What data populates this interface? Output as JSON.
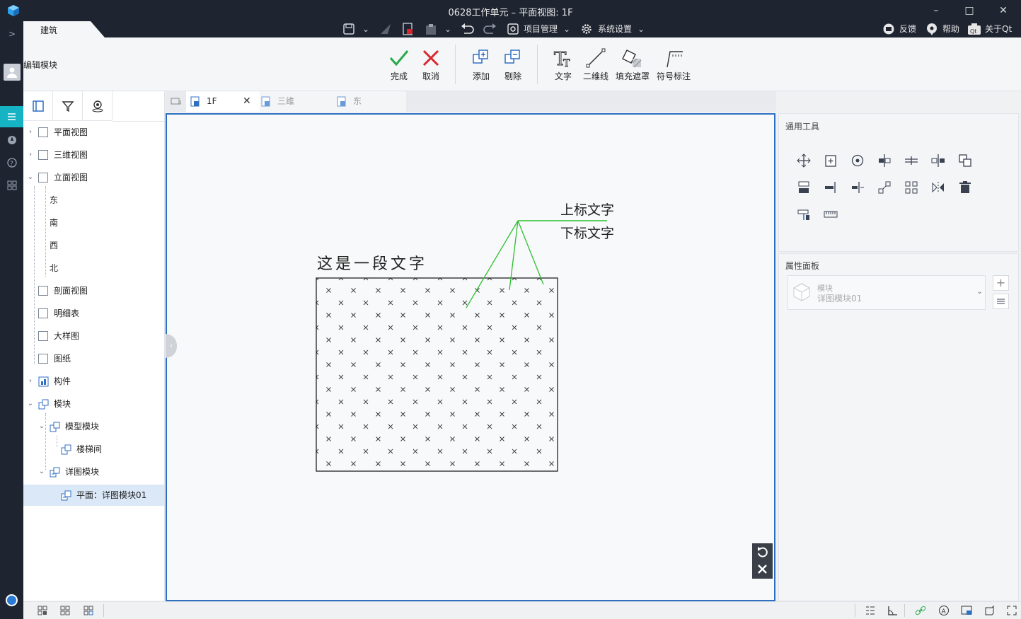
{
  "window": {
    "title": "0628工作单元 – 平面视图: 1F",
    "min": "–",
    "max": "□",
    "close": "✕"
  },
  "menubar": {
    "active_tab": "建筑",
    "project_menu": "项目管理",
    "settings_menu": "系统设置",
    "feedback": "反馈",
    "help": "帮助",
    "about": "关于Qt"
  },
  "ribbon": {
    "mode_label": "编辑模块",
    "buttons": [
      {
        "label": "完成",
        "icon": "check-icon"
      },
      {
        "label": "取消",
        "icon": "cross-icon"
      },
      {
        "label": "添加",
        "icon": "add-block-icon"
      },
      {
        "label": "剔除",
        "icon": "remove-block-icon"
      },
      {
        "label": "文字",
        "icon": "text-icon"
      },
      {
        "label": "二维线",
        "icon": "line-icon"
      },
      {
        "label": "填充遮罩",
        "icon": "fill-mask-icon"
      },
      {
        "label": "符号标注",
        "icon": "symbol-annotation-icon"
      }
    ]
  },
  "tree": {
    "items": [
      {
        "label": "平面视图",
        "expanded": false
      },
      {
        "label": "三维视图",
        "expanded": false
      },
      {
        "label": "立面视图",
        "expanded": true
      },
      {
        "label": "东"
      },
      {
        "label": "南"
      },
      {
        "label": "西"
      },
      {
        "label": "北"
      },
      {
        "label": "剖面视图"
      },
      {
        "label": "明细表"
      },
      {
        "label": "大样图"
      },
      {
        "label": "图纸"
      },
      {
        "label": "构件",
        "expanded": false
      },
      {
        "label": "模块",
        "expanded": true
      },
      {
        "label": "模型模块",
        "expanded": true
      },
      {
        "label": "楼梯间"
      },
      {
        "label": "详图模块",
        "expanded": true
      },
      {
        "label": "平面：详图模块01",
        "selected": true
      }
    ]
  },
  "view_tabs": [
    {
      "label": "1F",
      "active": true
    },
    {
      "label": "三维",
      "active": false
    },
    {
      "label": "东",
      "active": false
    }
  ],
  "drawing": {
    "main_text": "这是一段文字",
    "upper_label": "上标文字",
    "lower_label": "下标文字"
  },
  "right_panel": {
    "tools_title": "通用工具",
    "props_title": "属性面板",
    "type_category": "模块",
    "type_name": "详图模块01"
  },
  "colors": {
    "accent": "#2f6fc2",
    "leader": "#2fbf2f",
    "check": "#2aa84a",
    "cancel": "#d8262b",
    "rail": "#1e2430"
  }
}
